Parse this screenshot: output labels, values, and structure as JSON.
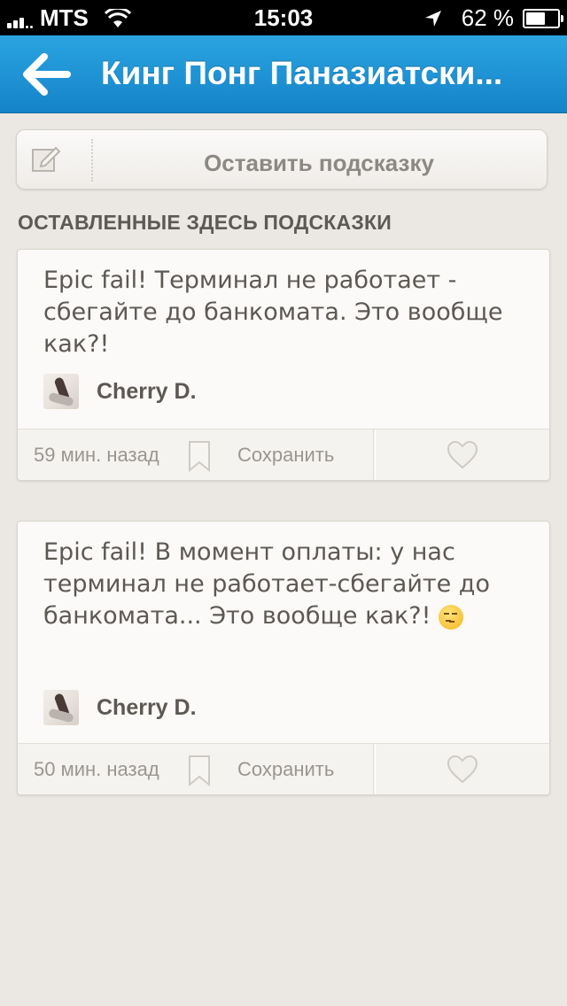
{
  "status_bar": {
    "carrier": "MTS",
    "time": "15:03",
    "battery": "62 %",
    "battery_level": 0.62,
    "icons": [
      "signal-icon",
      "wifi-icon",
      "location-arrow-icon",
      "battery-icon"
    ]
  },
  "header": {
    "back_icon": "back-arrow-icon",
    "title": "Кинг Понг Паназиатски..."
  },
  "leave_tip": {
    "icon": "compose-icon",
    "label": "Оставить подсказку"
  },
  "section_title": "ОСТАВЛЕННЫЕ ЗДЕСЬ ПОДСКАЗКИ",
  "tips": [
    {
      "text": "Epic fail! Терминал не работает - сбегайте до банкомата. Это вообще как?!",
      "author": "Cherry D.",
      "time_ago": "59 мин. назад",
      "save_label": "Сохранить"
    },
    {
      "text": "Epic fail! В момент оплаты: у нас терминал не работает-сбегайте до банкомата... Это вообще как?!",
      "emoji": "smirk-emoji",
      "author": "Cherry D.",
      "time_ago": "50 мин. назад",
      "save_label": "Сохранить"
    }
  ],
  "colors": {
    "header": "#1e94d6",
    "background": "#ebe7e2",
    "card": "#fbfaf8",
    "text": "#5d5853",
    "muted": "#9a9590"
  }
}
